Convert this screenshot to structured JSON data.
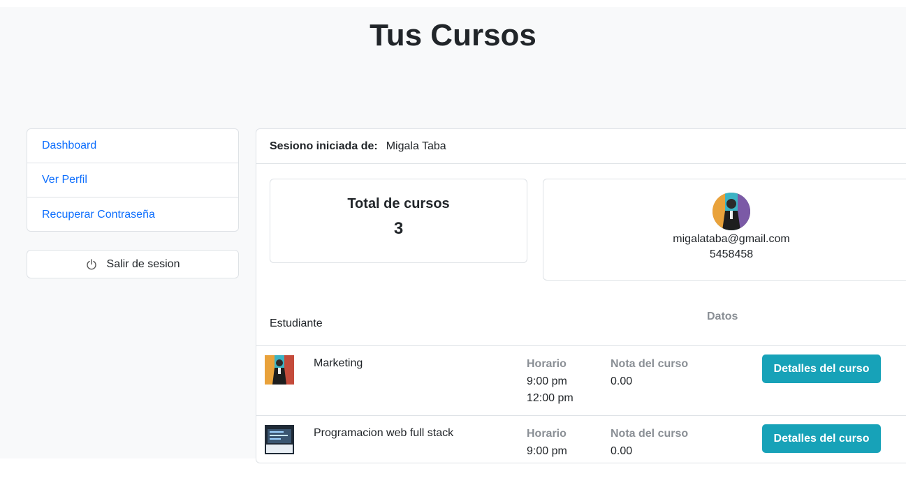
{
  "page": {
    "title": "Tus Cursos"
  },
  "sidebar": {
    "items": [
      {
        "label": "Dashboard"
      },
      {
        "label": "Ver Perfil"
      },
      {
        "label": "Recuperar Contraseña"
      }
    ],
    "logout": {
      "label": "Salir de sesion",
      "icon": "power-icon"
    }
  },
  "session": {
    "label": "Sesiono iniciada de:",
    "user": "Migala Taba"
  },
  "stats": {
    "title": "Total de cursos",
    "value": "3"
  },
  "profile": {
    "email": "migalataba@gmail.com",
    "phone": "5458458"
  },
  "table": {
    "col_student": "Estudiante",
    "col_data": "Datos"
  },
  "courses": [
    {
      "name": "Marketing",
      "schedule_label": "Horario",
      "schedule": [
        "9:00 pm",
        "12:00 pm"
      ],
      "grade_label": "Nota del curso",
      "grade": "0.00",
      "button": "Detalles del curso"
    },
    {
      "name": "Programacion web full stack",
      "schedule_label": "Horario",
      "schedule": [
        "9:00 pm",
        ""
      ],
      "grade_label": "Nota del curso",
      "grade": "0.00",
      "button": "Detalles del curso"
    }
  ],
  "colors": {
    "link": "#0d6efd",
    "accent": "#17a2b8",
    "muted": "#8a8f95"
  }
}
